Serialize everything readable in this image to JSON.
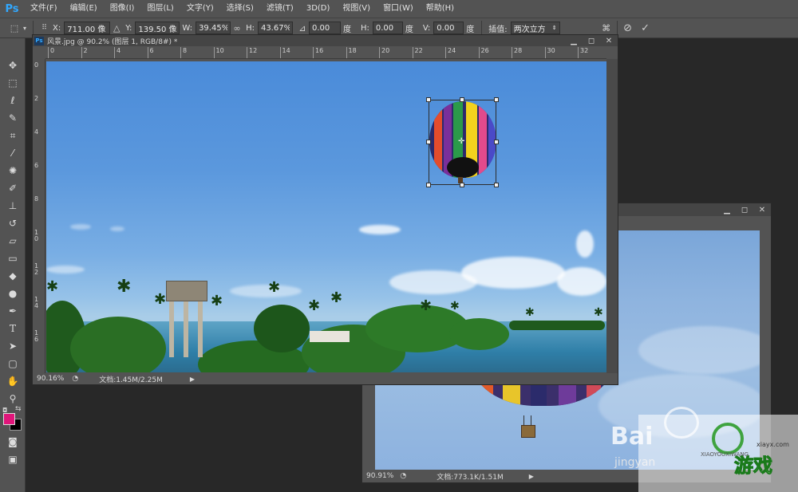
{
  "app": {
    "logo": "Ps"
  },
  "menu": [
    "文件(F)",
    "编辑(E)",
    "图像(I)",
    "图层(L)",
    "文字(Y)",
    "选择(S)",
    "滤镜(T)",
    "3D(D)",
    "视图(V)",
    "窗口(W)",
    "帮助(H)"
  ],
  "options": {
    "x_label": "X:",
    "x_value": "711.00 像",
    "y_label": "Y:",
    "y_value": "139.50 像",
    "w_label": "W:",
    "w_value": "39.45%",
    "h_label": "H:",
    "h_value": "43.67%",
    "angle_value": "0.00",
    "angle_unit": "度",
    "hskew_label": "H:",
    "hskew_value": "0.00",
    "hskew_unit": "度",
    "vskew_label": "V:",
    "vskew_value": "0.00",
    "vskew_unit": "度",
    "interp_label": "插值:",
    "interp_value": "两次立方"
  },
  "main_doc": {
    "title": "风景.jpg @ 90.2% (图层 1, RGB/8#) *",
    "ruler_top": [
      "0",
      "2",
      "4",
      "6",
      "8",
      "10",
      "12",
      "14",
      "16",
      "18",
      "20",
      "22",
      "24",
      "26",
      "28",
      "30",
      "32"
    ],
    "ruler_left": [
      "0",
      "2",
      "4",
      "6",
      "8",
      "1 0",
      "1 2",
      "1 4",
      "1 6"
    ],
    "zoom": "90.16%",
    "doc_info": "文档:1.45M/2.25M"
  },
  "second_doc": {
    "zoom": "90.91%",
    "doc_info": "文档:773.1K/1.51M"
  },
  "watermarks": {
    "baidu": "Bai",
    "jingyan": "jingyan",
    "site": "xiayx.com",
    "game_text": "游戏",
    "game_sub": "XIAOYOUXIWANG"
  },
  "colors": {
    "foreground": "#e0157a",
    "background": "#000000",
    "accent": "#31a8ff"
  }
}
